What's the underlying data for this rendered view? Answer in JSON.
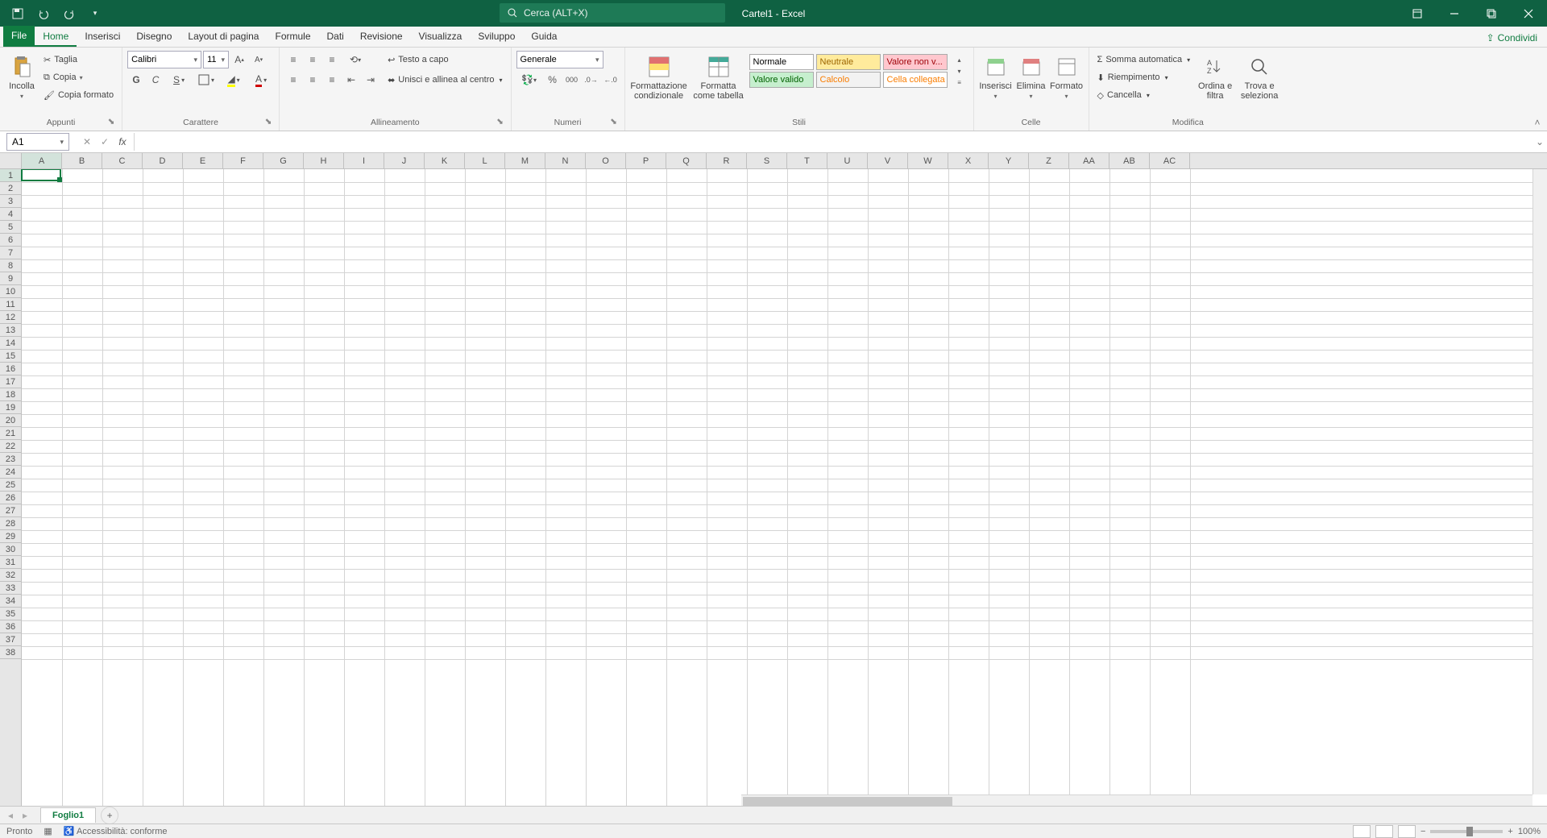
{
  "titlebar": {
    "doc_name": "Cartel1",
    "app_sep": " - ",
    "app_name": "Excel",
    "search_placeholder": "Cerca (ALT+X)"
  },
  "tabs": {
    "file": "File",
    "home": "Home",
    "inserisci": "Inserisci",
    "disegno": "Disegno",
    "layout": "Layout di pagina",
    "formule": "Formule",
    "dati": "Dati",
    "revisione": "Revisione",
    "visualizza": "Visualizza",
    "sviluppo": "Sviluppo",
    "guida": "Guida",
    "condividi": "Condividi"
  },
  "ribbon": {
    "clipboard": {
      "label": "Appunti",
      "paste": "Incolla",
      "cut": "Taglia",
      "copy": "Copia",
      "format_painter": "Copia formato"
    },
    "font": {
      "label": "Carattere",
      "family": "Calibri",
      "size": "11",
      "bold": "G",
      "italic": "C",
      "underline": "S"
    },
    "alignment": {
      "label": "Allineamento",
      "wrap": "Testo a capo",
      "merge": "Unisci e allinea al centro"
    },
    "number": {
      "label": "Numeri",
      "format": "Generale"
    },
    "styles": {
      "label": "Stili",
      "cond_format": "Formattazione condizionale",
      "table_format": "Formatta come tabella",
      "normale": "Normale",
      "neutrale": "Neutrale",
      "valore_nv": "Valore non v...",
      "valore_valido": "Valore valido",
      "calcolo": "Calcolo",
      "cella_coll": "Cella collegata"
    },
    "cells": {
      "label": "Celle",
      "insert": "Inserisci",
      "delete": "Elimina",
      "format": "Formato"
    },
    "editing": {
      "label": "Modifica",
      "autosum": "Somma automatica",
      "fill": "Riempimento",
      "clear": "Cancella",
      "sort": "Ordina e filtra",
      "find": "Trova e seleziona"
    }
  },
  "namebox": {
    "value": "A1"
  },
  "columns": [
    "A",
    "B",
    "C",
    "D",
    "E",
    "F",
    "G",
    "H",
    "I",
    "J",
    "K",
    "L",
    "M",
    "N",
    "O",
    "P",
    "Q",
    "R",
    "S",
    "T",
    "U",
    "V",
    "W",
    "X",
    "Y",
    "Z",
    "AA",
    "AB",
    "AC"
  ],
  "rows": [
    1,
    2,
    3,
    4,
    5,
    6,
    7,
    8,
    9,
    10,
    11,
    12,
    13,
    14,
    15,
    16,
    17,
    18,
    19,
    20,
    21,
    22,
    23,
    24,
    25,
    26,
    27,
    28,
    29,
    30,
    31,
    32,
    33,
    34,
    35,
    36,
    37,
    38
  ],
  "sheet": {
    "name": "Foglio1"
  },
  "statusbar": {
    "pronto": "Pronto",
    "access": "Accessibilità: conforme",
    "zoom": "100%"
  }
}
